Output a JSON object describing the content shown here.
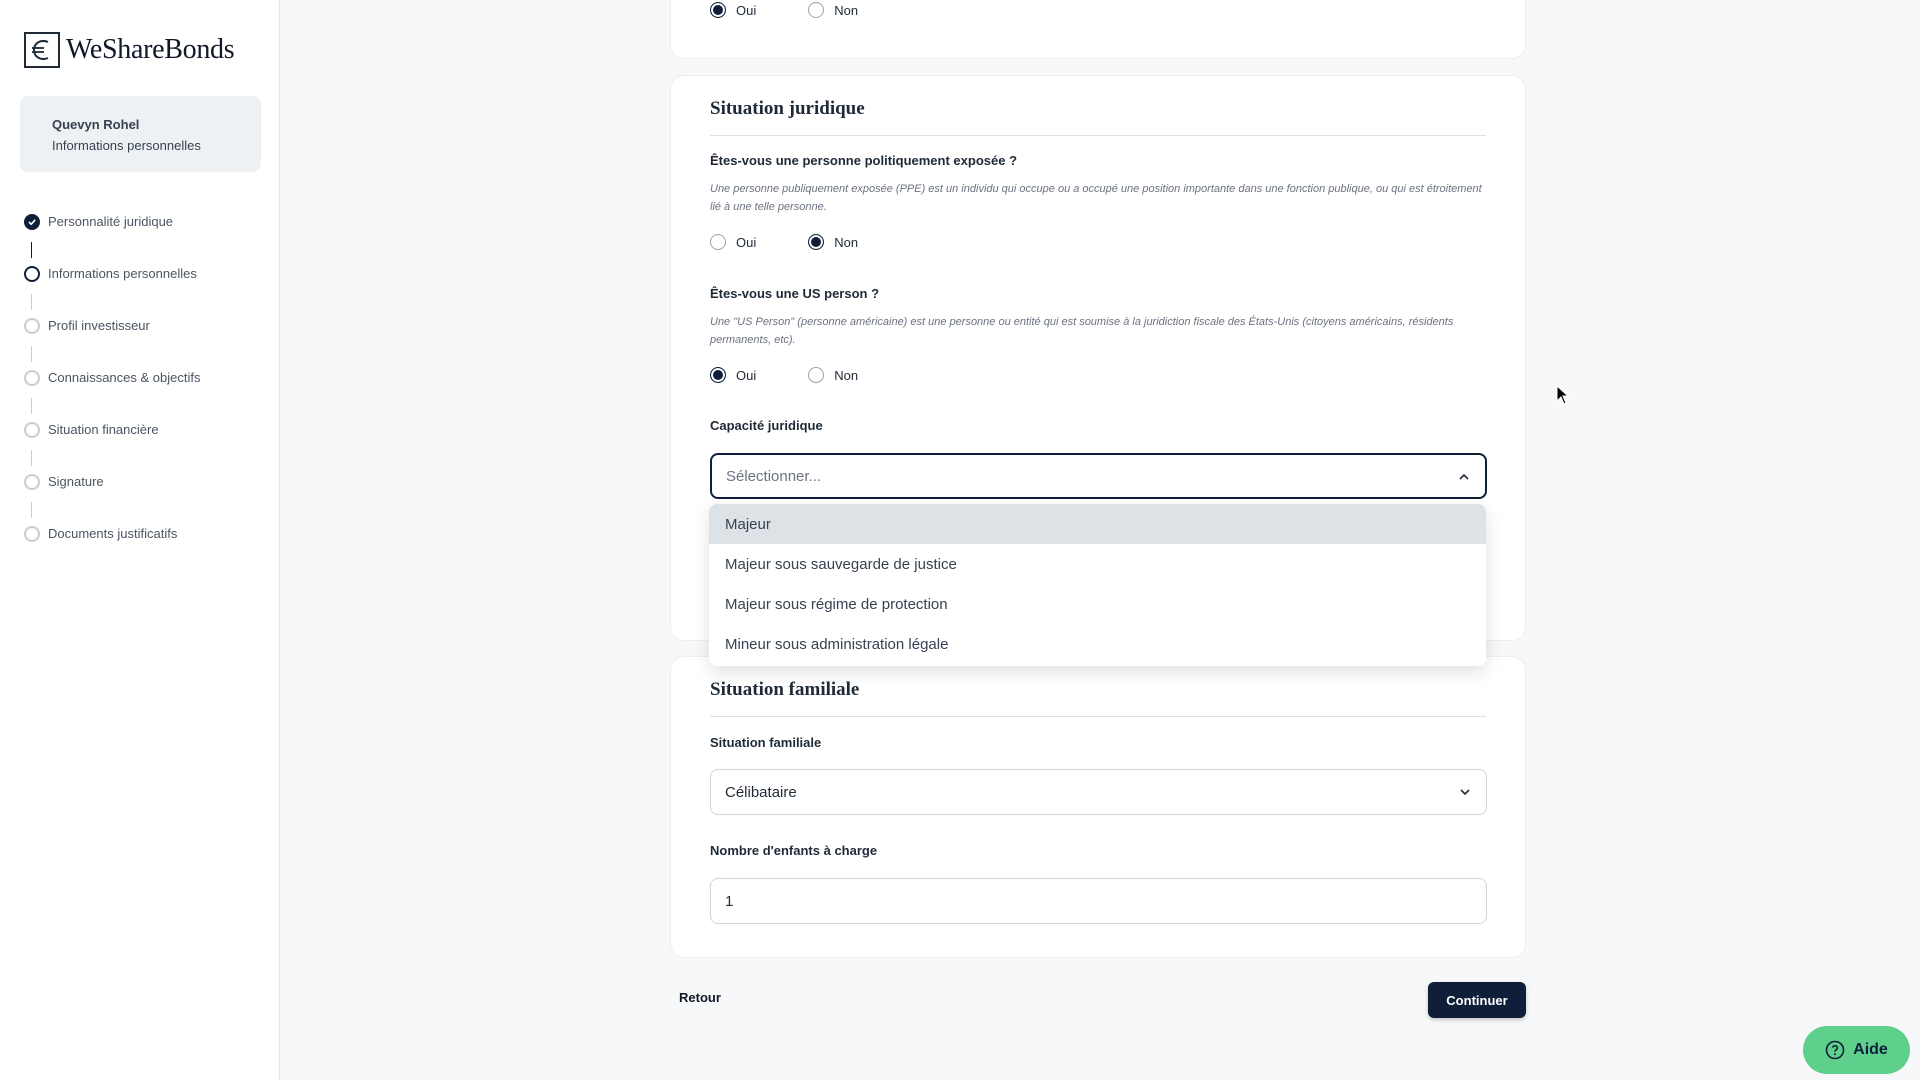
{
  "brand": {
    "name": "WeShareBonds",
    "icon": "euro-logo-icon"
  },
  "user": {
    "name": "Quevyn Rohel",
    "section": "Informations personnelles"
  },
  "steps": [
    {
      "label": "Personnalité juridique",
      "state": "done"
    },
    {
      "label": "Informations personnelles",
      "state": "current"
    },
    {
      "label": "Profil investisseur",
      "state": "pending"
    },
    {
      "label": "Connaissances & objectifs",
      "state": "pending"
    },
    {
      "label": "Situation financière",
      "state": "pending"
    },
    {
      "label": "Signature",
      "state": "pending"
    },
    {
      "label": "Documents justificatifs",
      "state": "pending"
    }
  ],
  "top_card": {
    "radio": {
      "oui": "Oui",
      "non": "Non",
      "selected": "Oui"
    }
  },
  "juridique": {
    "title": "Situation juridique",
    "ppe": {
      "label": "Êtes-vous une personne politiquement exposée ?",
      "help": "Une personne publiquement exposée (PPE) est un individu qui occupe ou a occupé une position importante dans une fonction publique, ou qui est étroitement lié à une telle personne.",
      "oui": "Oui",
      "non": "Non",
      "selected": "Non"
    },
    "us": {
      "label": "Êtes-vous une US person ?",
      "help": "Une \"US Person\" (personne américaine) est une personne ou entité qui est soumise à la juridiction fiscale des États-Unis (citoyens américains, résidents permanents, etc).",
      "oui": "Oui",
      "non": "Non",
      "selected": "Oui"
    },
    "capacite": {
      "label": "Capacité juridique",
      "placeholder": "Sélectionner...",
      "options": [
        "Majeur",
        "Majeur sous sauvegarde de justice",
        "Majeur sous régime de protection",
        "Mineur sous administration légale"
      ],
      "highlighted": "Majeur"
    }
  },
  "familiale": {
    "title": "Situation familiale",
    "situation_label": "Situation familiale",
    "situation_value": "Célibataire",
    "enfants_label": "Nombre d'enfants à charge",
    "enfants_value": "1"
  },
  "actions": {
    "back": "Retour",
    "continue": "Continuer",
    "help": "Aide"
  },
  "colors": {
    "primary": "#0f1f3a",
    "help_button": "#5fcf8c",
    "highlight": "#dde2e6"
  }
}
